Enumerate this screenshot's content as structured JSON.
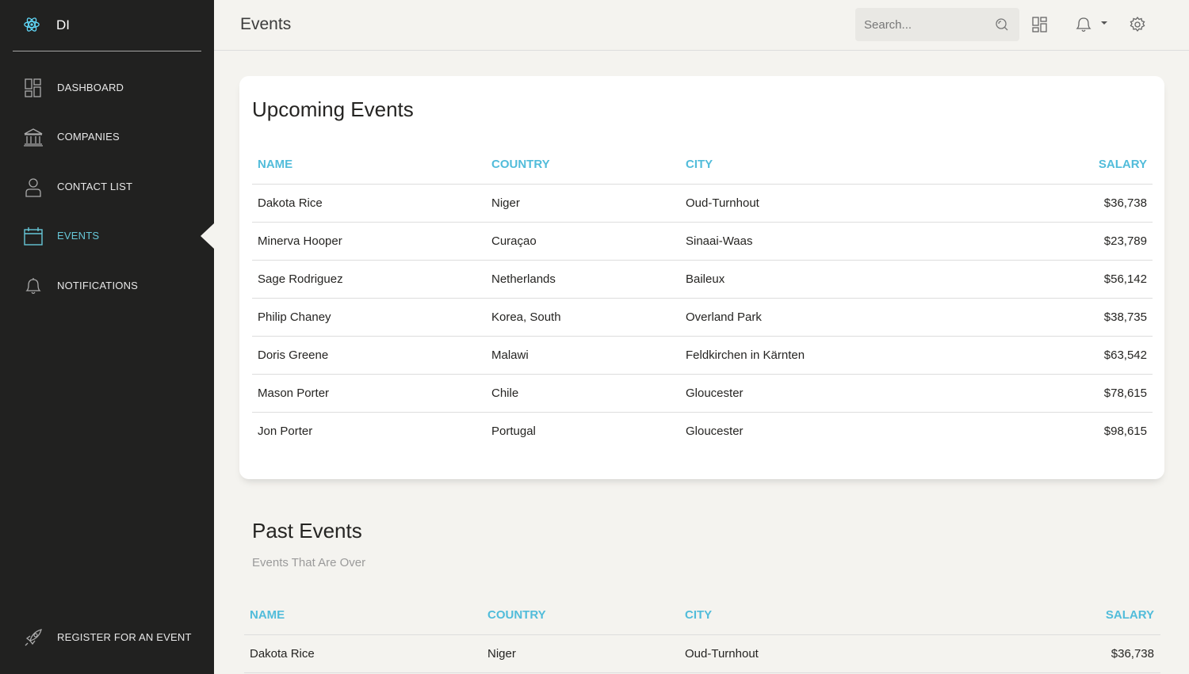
{
  "brand": {
    "text": "DI"
  },
  "sidebar": {
    "items": [
      {
        "label": "DASHBOARD",
        "icon": "dashboard-icon"
      },
      {
        "label": "COMPANIES",
        "icon": "bank-icon"
      },
      {
        "label": "CONTACT LIST",
        "icon": "user-icon"
      },
      {
        "label": "EVENTS",
        "icon": "calendar-icon",
        "active": true
      },
      {
        "label": "NOTIFICATIONS",
        "icon": "bell-icon"
      }
    ],
    "footer": {
      "label": "REGISTER FOR AN EVENT",
      "icon": "rocket-icon"
    }
  },
  "header": {
    "title": "Events",
    "search_placeholder": "Search..."
  },
  "upcoming": {
    "title": "Upcoming Events",
    "columns": [
      "NAME",
      "COUNTRY",
      "CITY",
      "SALARY"
    ],
    "rows": [
      [
        "Dakota Rice",
        "Niger",
        "Oud-Turnhout",
        "$36,738"
      ],
      [
        "Minerva Hooper",
        "Curaçao",
        "Sinaai-Waas",
        "$23,789"
      ],
      [
        "Sage Rodriguez",
        "Netherlands",
        "Baileux",
        "$56,142"
      ],
      [
        "Philip Chaney",
        "Korea, South",
        "Overland Park",
        "$38,735"
      ],
      [
        "Doris Greene",
        "Malawi",
        "Feldkirchen in Kärnten",
        "$63,542"
      ],
      [
        "Mason Porter",
        "Chile",
        "Gloucester",
        "$78,615"
      ],
      [
        "Jon Porter",
        "Portugal",
        "Gloucester",
        "$98,615"
      ]
    ]
  },
  "past": {
    "title": "Past Events",
    "subtitle": "Events That Are Over",
    "columns": [
      "NAME",
      "COUNTRY",
      "CITY",
      "SALARY"
    ],
    "rows": [
      [
        "Dakota Rice",
        "Niger",
        "Oud-Turnhout",
        "$36,738"
      ]
    ]
  },
  "colors": {
    "sidebar_bg": "#212120",
    "accent": "#51bcda",
    "active_nav": "#66c7d8",
    "page_bg": "#f4f3ef"
  }
}
